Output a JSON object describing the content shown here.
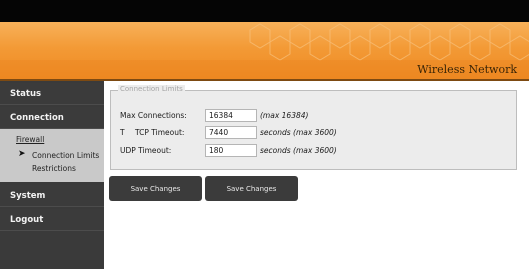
{
  "header": {
    "brand": "Wireless Network"
  },
  "sidebar": {
    "items": [
      {
        "id": "status",
        "label": "Status"
      },
      {
        "id": "connection",
        "label": "Connection"
      },
      {
        "id": "system",
        "label": "System"
      },
      {
        "id": "logout",
        "label": "Logout"
      }
    ],
    "sub": {
      "firewall": "Firewall",
      "connection_limits": "Connection Limits",
      "restrictions": "Restrictions",
      "arrow_icon": "arrow-right-icon"
    }
  },
  "main": {
    "section_title": "Connection Limits",
    "rows": [
      {
        "label": "Max Connections:",
        "value": "16384",
        "hint": "(max 16384)"
      },
      {
        "label": "TCP Timeout:",
        "prefix": "T",
        "value": "7440",
        "hint": "seconds (max 3600)"
      },
      {
        "label": "UDP Timeout:",
        "value": "180",
        "hint": "seconds (max 3600)"
      }
    ],
    "buttons": [
      {
        "label": "Save Changes"
      },
      {
        "label": "Save Changes"
      }
    ]
  },
  "colors": {
    "banner": "#f39a36",
    "sidebar": "#3b3b3b",
    "panel": "#ececec"
  }
}
